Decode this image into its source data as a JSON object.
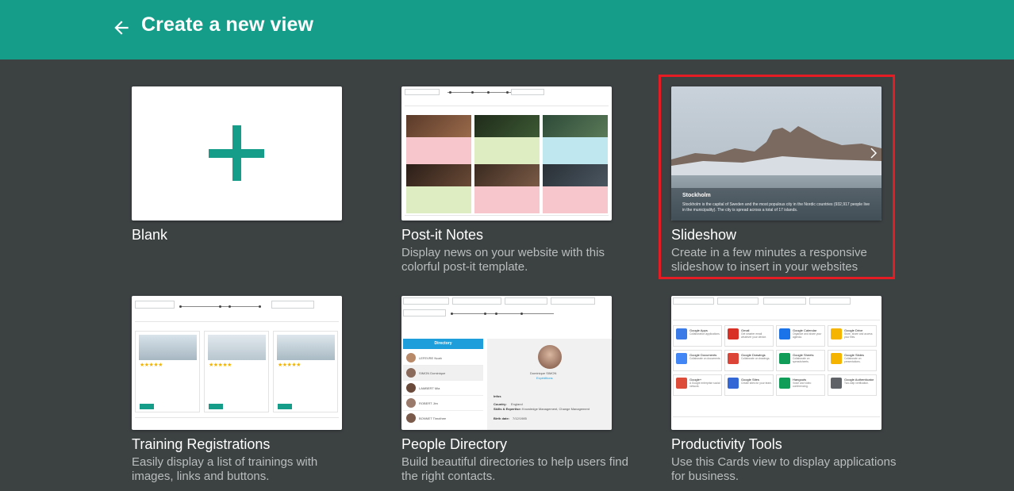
{
  "header": {
    "title": "Create a new view",
    "bg_color": "#169d8a"
  },
  "views": [
    {
      "title": "Blank",
      "description": ""
    },
    {
      "title": "Post-it Notes",
      "description": "Display news on your website with this colorful post-it template."
    },
    {
      "title": "Slideshow",
      "description": "Create in a few minutes a responsive slideshow to insert in your websites",
      "selected": true,
      "preview": {
        "caption_title": "Stockholm",
        "caption_text": "Stockholm is the capital of Sweden and the most populous city in the Nordic countries (932,917 people live in the municipality). The city is spread across a total of 17 islands."
      }
    },
    {
      "title": "Training Registrations",
      "description": "Easily display a list of trainings with images, links and buttons."
    },
    {
      "title": "People Directory",
      "description": "Build beautiful directories to help users find the right contacts.",
      "preview": {
        "directory_header": "Directory",
        "people": [
          "LEFEVRE Noah",
          "SIMON Dominique",
          "LAMBERT Mia",
          "ROBERT Jim",
          "BONNET Timothee"
        ],
        "profile_name": "Dominique SIMON",
        "profile_role": "Expéditions",
        "info_label": "Infos",
        "country_label": "Country:",
        "country_value": "England",
        "skills_label": "Skills & Expertise:",
        "skills_value": "Knowledge Management, Change Management",
        "birth_label": "Birth date:",
        "birth_value": "7/12/1985"
      }
    },
    {
      "title": "Productivity Tools",
      "description": "Use this Cards view to display applications for business.",
      "preview": {
        "apps": [
          {
            "name": "Google Apps",
            "desc": "Collaboration applications.",
            "color": "#3b7be8"
          },
          {
            "name": "Gmail",
            "desc": "Get smarter email whatever your device.",
            "color": "#d93025"
          },
          {
            "name": "Google Calendar",
            "desc": "Organize and share your agenda.",
            "color": "#1a73e8"
          },
          {
            "name": "Google Drive",
            "desc": "Store, share and access your files.",
            "color": "#f4b400"
          },
          {
            "name": "Google Documents",
            "desc": "Collaborate on documents.",
            "color": "#4285f4"
          },
          {
            "name": "Google Drawings",
            "desc": "Collaborate on drawings.",
            "color": "#db4437"
          },
          {
            "name": "Google Sheets",
            "desc": "Collaborate on spreadsheets.",
            "color": "#0f9d58"
          },
          {
            "name": "Google Slides",
            "desc": "Collaborate on presentations.",
            "color": "#f4b400"
          },
          {
            "name": "Google+",
            "desc": "A Google enterprise social network.",
            "color": "#dd4b39"
          },
          {
            "name": "Google Sites",
            "desc": "Create sites for your team.",
            "color": "#3367d6"
          },
          {
            "name": "Hangouts",
            "desc": "Voice and video conferencing.",
            "color": "#0f9d58"
          },
          {
            "name": "Google Authenticator",
            "desc": "Two-step verification.",
            "color": "#5f6368"
          }
        ]
      }
    }
  ]
}
